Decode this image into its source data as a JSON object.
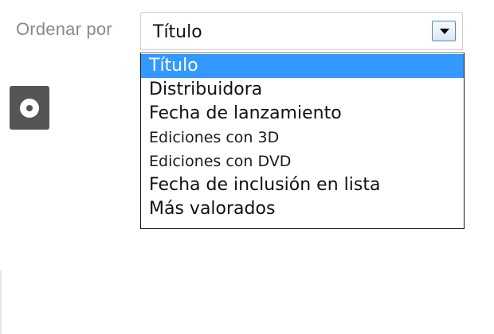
{
  "sort": {
    "label": "Ordenar por",
    "selected": "Título",
    "options": [
      "Título",
      "Distribuidora",
      "Fecha de lanzamiento",
      "Ediciones con 3D",
      "Ediciones con DVD",
      "Fecha de inclusión en lista",
      "Más valorados"
    ]
  },
  "icons": {
    "disc": "disc-icon",
    "dropdown_arrow": "chevron-down-icon"
  },
  "colors": {
    "highlight": "#3399ff",
    "label": "#8a8a8a",
    "icon_bg": "#555555"
  }
}
